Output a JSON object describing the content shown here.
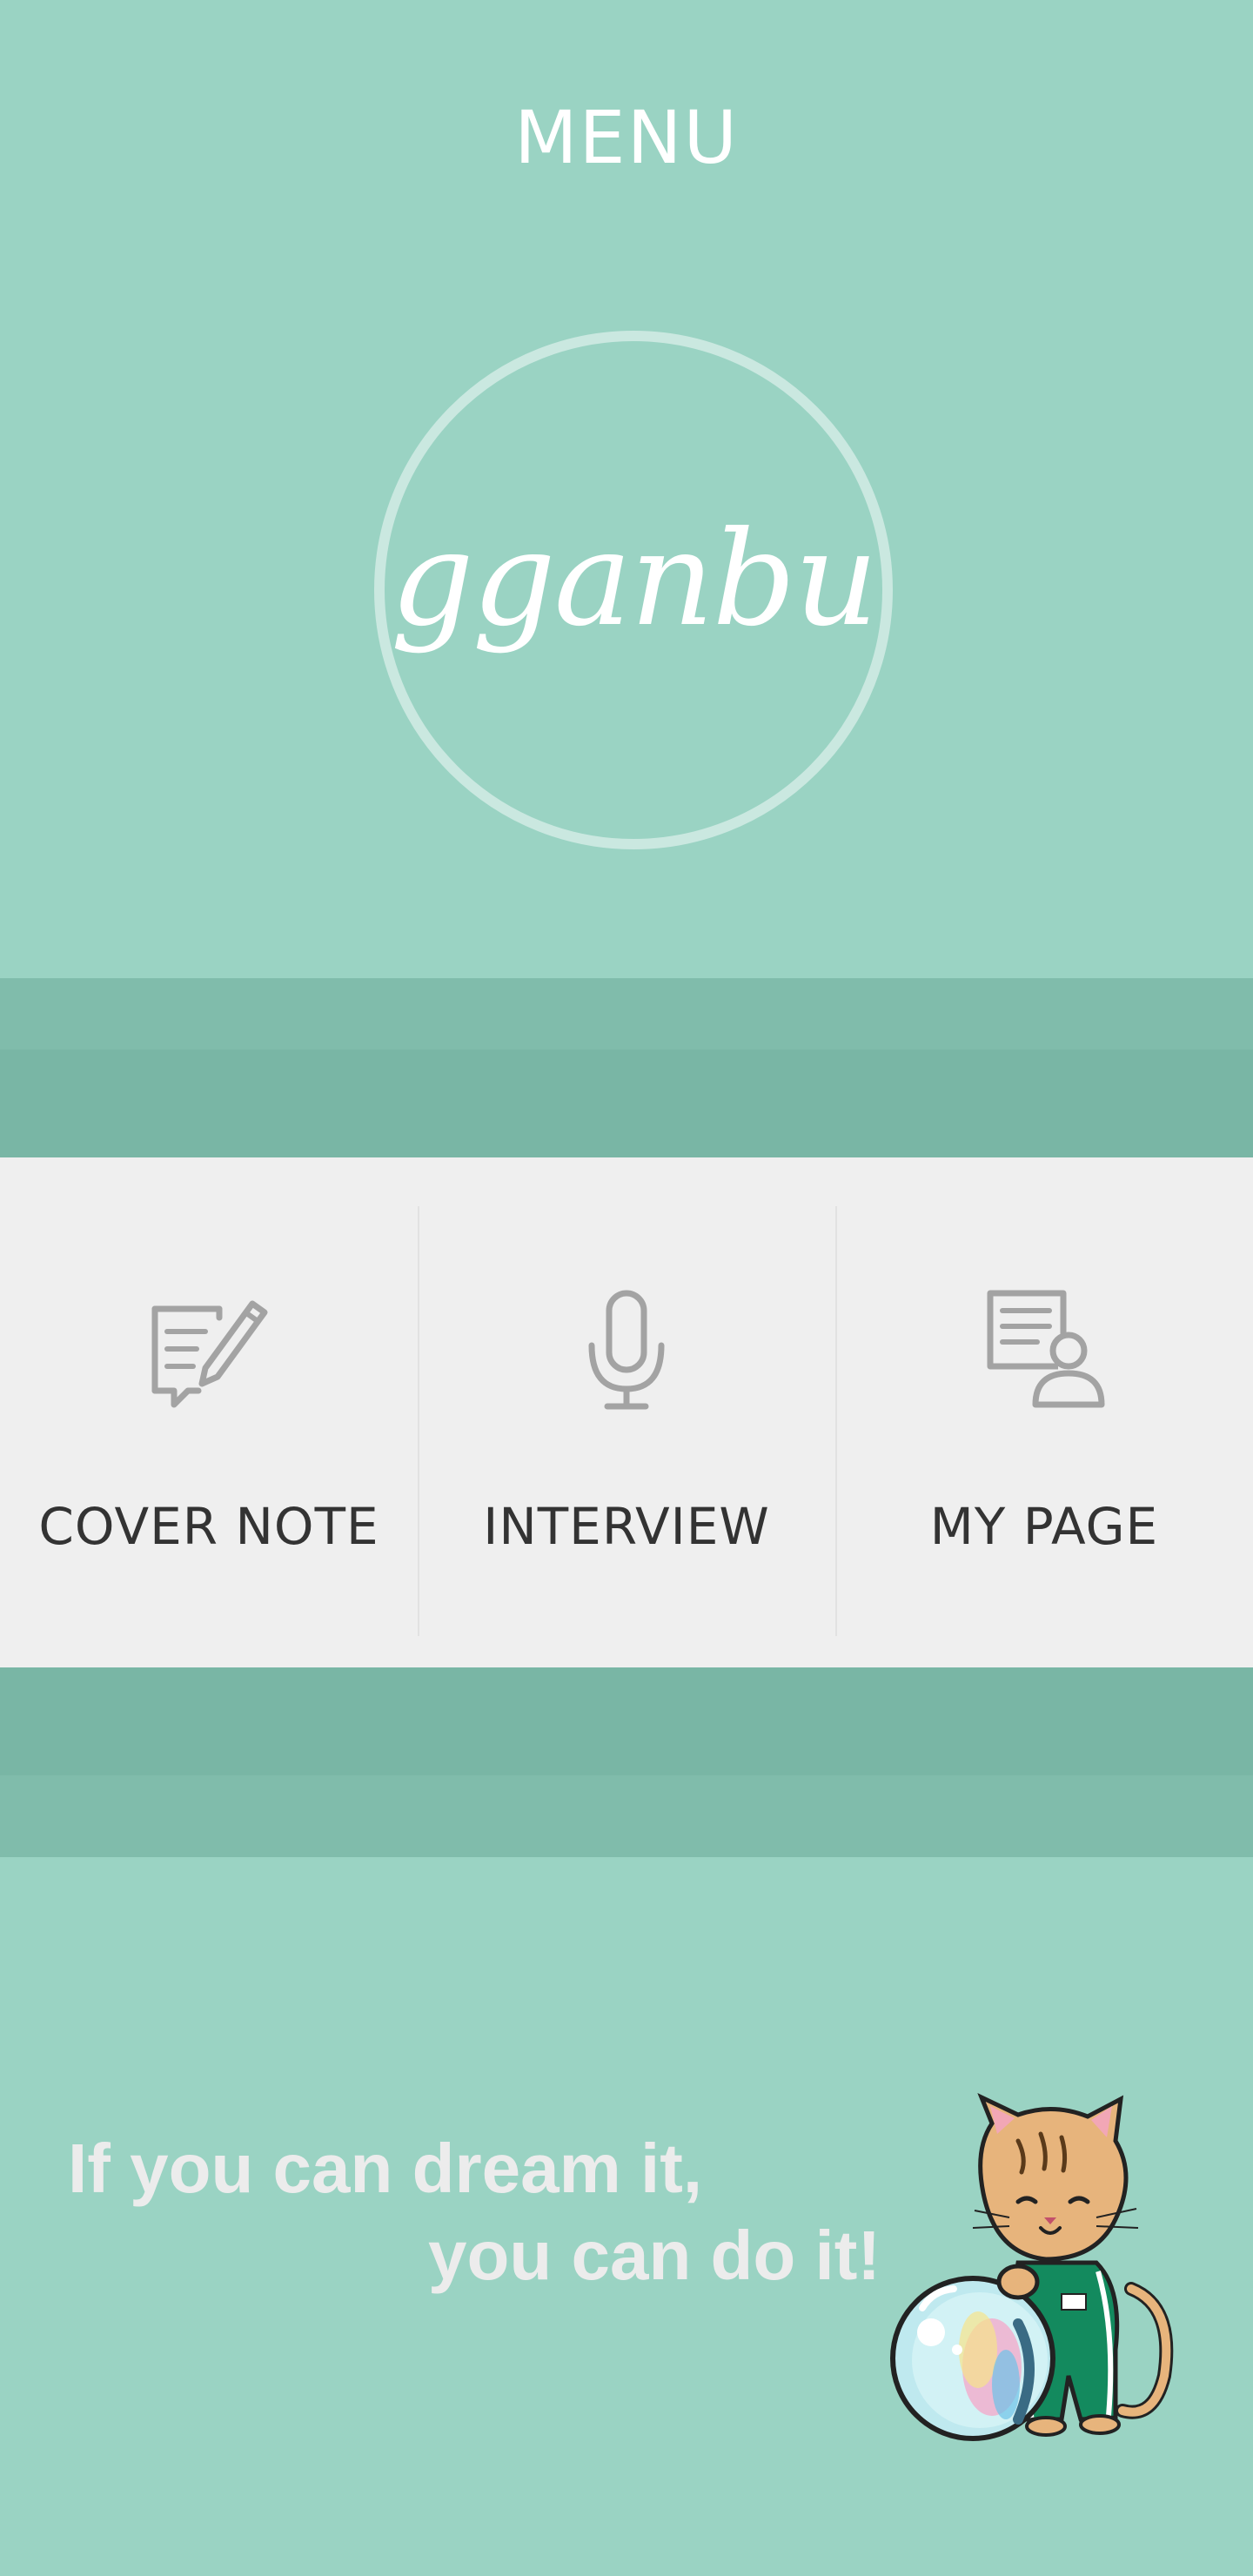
{
  "header": {
    "title": "MENU"
  },
  "logo": {
    "text": "gganbu"
  },
  "menu": {
    "items": [
      {
        "label": "COVER NOTE",
        "icon": "edit-note-icon"
      },
      {
        "label": "INTERVIEW",
        "icon": "microphone-icon"
      },
      {
        "label": "MY PAGE",
        "icon": "user-document-icon"
      }
    ]
  },
  "slogan": {
    "line1": "If you can dream it,",
    "line2": "you can do it!"
  },
  "colors": {
    "background": "#9ad3c3",
    "band_light": "#80bcab",
    "band_dark": "#79b6a5",
    "panel": "#efefef",
    "icon_gray": "#a3a3a3",
    "text_dark": "#333333"
  }
}
